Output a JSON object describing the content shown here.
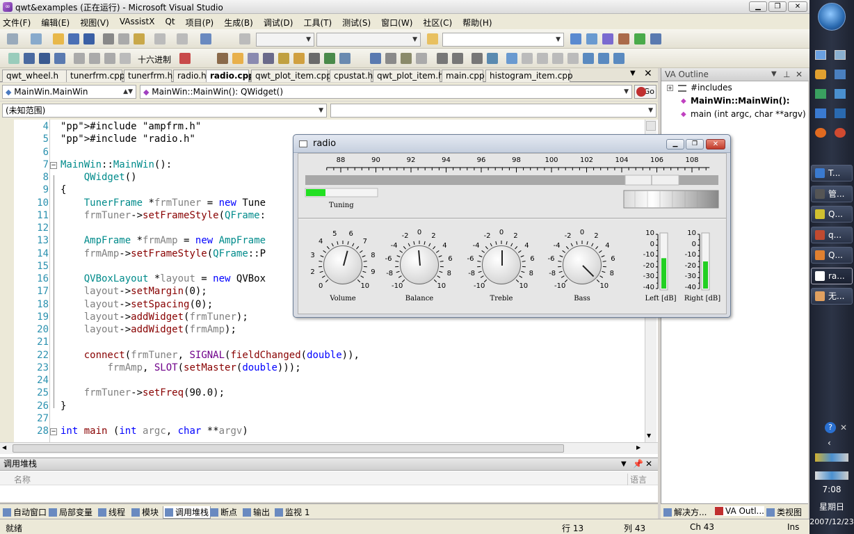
{
  "window": {
    "title": "qwt&examples (正在运行) - Microsoft Visual Studio"
  },
  "menu": [
    "文件(F)",
    "编辑(E)",
    "视图(V)",
    "VAssistX",
    "Qt",
    "项目(P)",
    "生成(B)",
    "调试(D)",
    "工具(T)",
    "测试(S)",
    "窗口(W)",
    "社区(C)",
    "帮助(H)"
  ],
  "toolbar": {
    "hex_label": "十六进制"
  },
  "tabs": [
    "qwt_wheel.h",
    "tunerfrm.cpp",
    "tunerfrm.h",
    "radio.h",
    "radio.cpp",
    "qwt_plot_item.cpp",
    "cpustat.h",
    "qwt_plot_item.h",
    "main.cpp",
    "histogram_item.cpp"
  ],
  "active_tab": "radio.cpp",
  "nav": {
    "scope": "MainWin.MainWin",
    "member": "MainWin::MainWin(): QWidget()",
    "go_label": "Go",
    "range": "(未知范围)"
  },
  "editor": {
    "lines": [
      {
        "n": "4",
        "t": "#include \"ampfrm.h\""
      },
      {
        "n": "5",
        "t": "#include \"radio.h\""
      },
      {
        "n": "6",
        "t": ""
      },
      {
        "n": "7",
        "t": "MainWin::MainWin():"
      },
      {
        "n": "8",
        "t": "    QWidget()"
      },
      {
        "n": "9",
        "t": "{"
      },
      {
        "n": "10",
        "t": "    TunerFrame *frmTuner = new Tune"
      },
      {
        "n": "11",
        "t": "    frmTuner->setFrameStyle(QFrame:"
      },
      {
        "n": "12",
        "t": ""
      },
      {
        "n": "13",
        "t": "    AmpFrame *frmAmp = new AmpFrame"
      },
      {
        "n": "14",
        "t": "    frmAmp->setFrameStyle(QFrame::P"
      },
      {
        "n": "15",
        "t": ""
      },
      {
        "n": "16",
        "t": "    QVBoxLayout *layout = new QVBox"
      },
      {
        "n": "17",
        "t": "    layout->setMargin(0);"
      },
      {
        "n": "18",
        "t": "    layout->setSpacing(0);"
      },
      {
        "n": "19",
        "t": "    layout->addWidget(frmTuner);"
      },
      {
        "n": "20",
        "t": "    layout->addWidget(frmAmp);"
      },
      {
        "n": "21",
        "t": ""
      },
      {
        "n": "22",
        "t": "    connect(frmTuner, SIGNAL(fieldChanged(double)),"
      },
      {
        "n": "23",
        "t": "        frmAmp, SLOT(setMaster(double)));"
      },
      {
        "n": "24",
        "t": ""
      },
      {
        "n": "25",
        "t": "    frmTuner->setFreq(90.0);"
      },
      {
        "n": "26",
        "t": "}"
      },
      {
        "n": "27",
        "t": ""
      },
      {
        "n": "28",
        "t": "int main (int argc, char **argv)"
      }
    ]
  },
  "callstack": {
    "title": "调用堆栈",
    "col_name": "名称",
    "col_lang": "语言"
  },
  "bottom_tabs": [
    "自动窗口",
    "局部变量",
    "线程",
    "模块",
    "调用堆栈",
    "断点",
    "输出",
    "监视 1"
  ],
  "status": {
    "ready": "就绪",
    "line": "行 13",
    "col": "列 43",
    "ch": "Ch 43",
    "ins": "Ins"
  },
  "va_outline": {
    "title": "VA Outline",
    "items": [
      "#includes",
      "MainWin::MainWin():",
      "main (int argc, char **argv)"
    ]
  },
  "va_tabs": [
    "解决方...",
    "VA Outl...",
    "类视图"
  ],
  "radio": {
    "title": "radio",
    "scale_labels": [
      "88",
      "90",
      "92",
      "94",
      "96",
      "98",
      "100",
      "102",
      "104",
      "106",
      "108"
    ],
    "tuning_label": "Tuning",
    "tuning_level": 0.27,
    "knobs": [
      {
        "name": "Volume",
        "ticks": [
          "0",
          "2",
          "3",
          "4",
          "5",
          "6",
          "7",
          "8",
          "9",
          "10"
        ],
        "value_deg": 15
      },
      {
        "name": "Balance",
        "ticks": [
          "-10",
          "-8",
          "-6",
          "-4",
          "-2",
          "0",
          "2",
          "4",
          "6",
          "8",
          "10"
        ],
        "value_deg": -5
      },
      {
        "name": "Treble",
        "ticks": [
          "-10",
          "-8",
          "-6",
          "-4",
          "-2",
          "0",
          "2",
          "4",
          "6",
          "8",
          "10"
        ],
        "value_deg": 0
      },
      {
        "name": "Bass",
        "ticks": [
          "-10",
          "-8",
          "-6",
          "-4",
          "-2",
          "0",
          "2",
          "4",
          "6",
          "8",
          "10"
        ],
        "value_deg": 135
      }
    ],
    "meters": [
      {
        "name": "Left [dB]",
        "ticks": [
          "10",
          "0",
          "-10",
          "-20",
          "-30",
          "-40"
        ],
        "level_db": -12
      },
      {
        "name": "Right [dB]",
        "ticks": [
          "10",
          "0",
          "-10",
          "-20",
          "-30",
          "-40"
        ],
        "level_db": -15
      }
    ]
  },
  "taskbar": {
    "buttons": [
      "T...",
      "管...",
      "Q...",
      "q...",
      "Q...",
      "ra...",
      "无..."
    ],
    "time": "7:08",
    "weekday": "星期日",
    "date": "2007/12/23"
  }
}
